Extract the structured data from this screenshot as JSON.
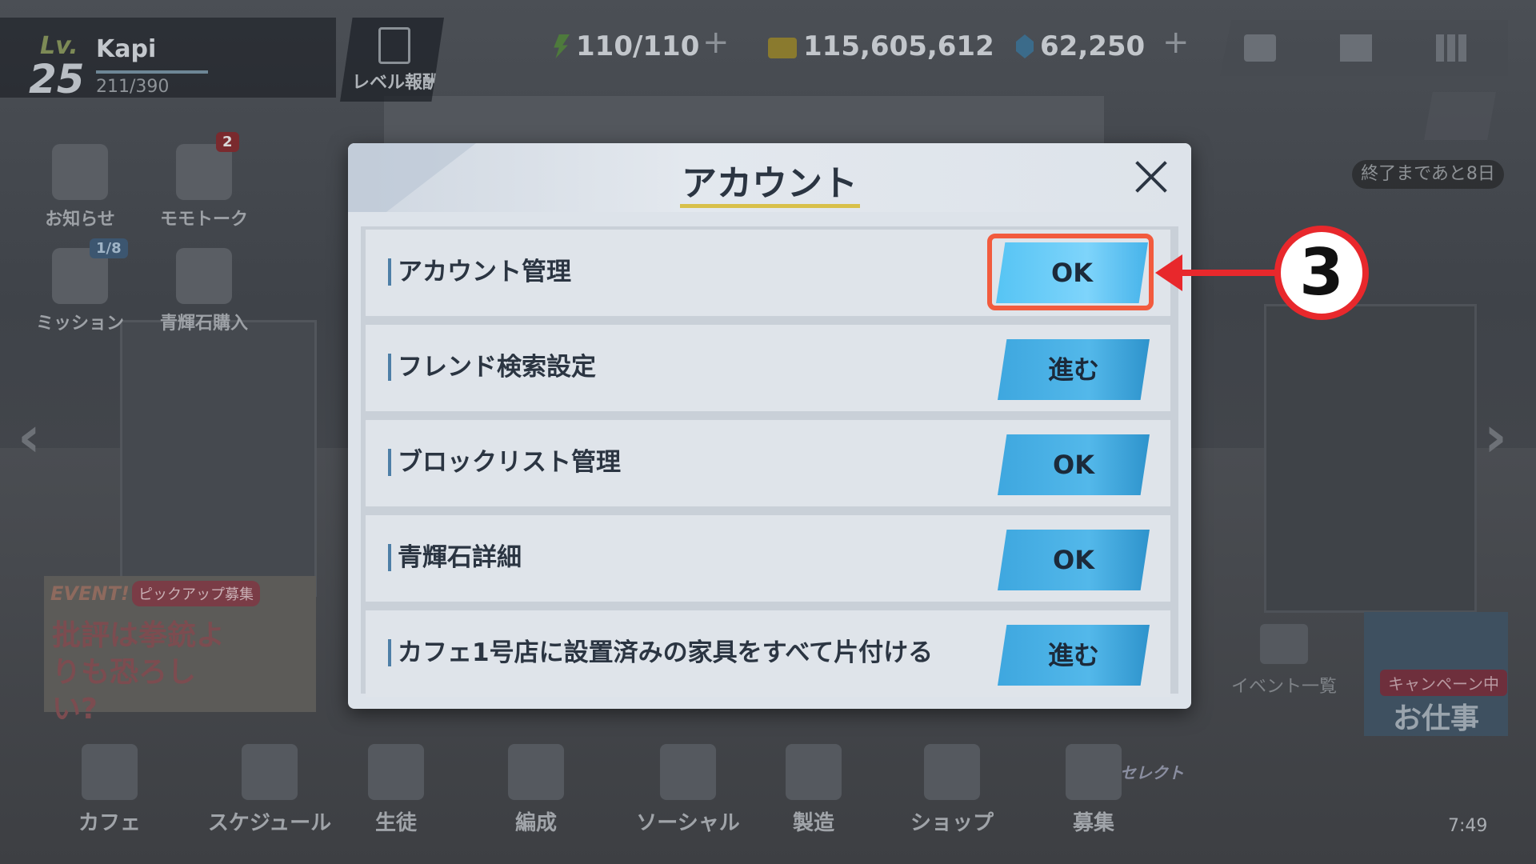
{
  "player": {
    "lv_label": "Lv.",
    "level": "25",
    "name": "Kapi",
    "exp": "211/390"
  },
  "level_reward": {
    "label": "レベル報酬"
  },
  "resources": {
    "ap": "110/110",
    "credits": "115,605,612",
    "gems": "62,250"
  },
  "event_timer": "終了まであと8日",
  "left_menu": [
    {
      "label": "お知らせ"
    },
    {
      "label": "モモトーク",
      "badge": "2"
    },
    {
      "label": "ミッション",
      "badge": "1/8"
    },
    {
      "label": "青輝石購入"
    }
  ],
  "event_banner": {
    "tag": "EVENT!",
    "sub": "ピックアップ募集",
    "title": "批評は拳銃よりも恐ろしい?"
  },
  "event_list": "イベント一覧",
  "work": {
    "tag": "キャンペーン中",
    "label": "お仕事"
  },
  "bottom_nav": [
    {
      "label": "カフェ"
    },
    {
      "label": "スケジュール"
    },
    {
      "label": "生徒"
    },
    {
      "label": "編成"
    },
    {
      "label": "ソーシャル"
    },
    {
      "label": "製造"
    },
    {
      "label": "ショップ"
    },
    {
      "label": "募集"
    }
  ],
  "recruit_badge": "セレクト",
  "clock": "7:49",
  "dialog": {
    "title": "アカウント",
    "rows": [
      {
        "label": "アカウント管理",
        "button": "OK"
      },
      {
        "label": "フレンド検索設定",
        "button": "進む"
      },
      {
        "label": "ブロックリスト管理",
        "button": "OK"
      },
      {
        "label": "青輝石詳細",
        "button": "OK"
      },
      {
        "label": "カフェ1号店に設置済みの家具をすべて片付ける",
        "button": "進む"
      }
    ]
  },
  "annotation": {
    "step": "3",
    "color": "#e8282c"
  },
  "colors": {
    "button": "#3ea7df",
    "highlight": "#f25b3e"
  }
}
